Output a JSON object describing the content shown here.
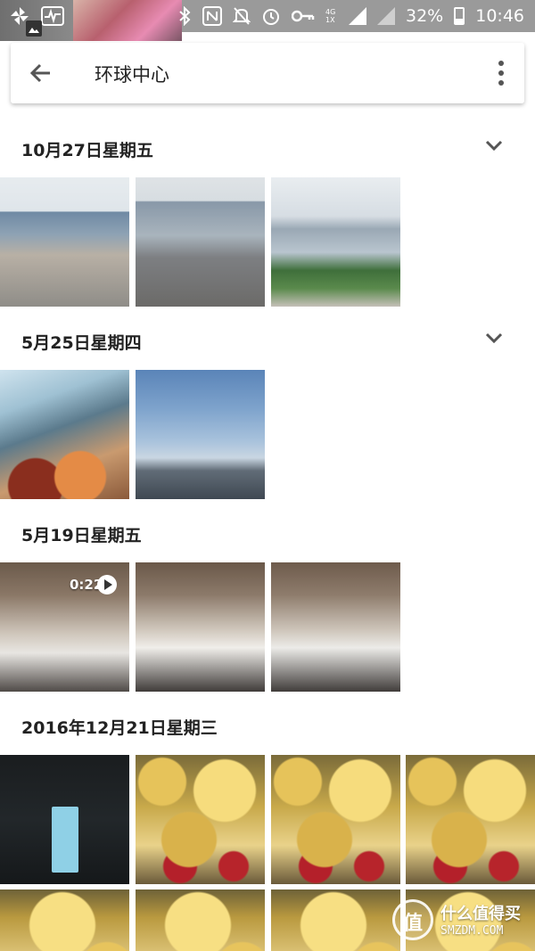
{
  "status_bar": {
    "battery_percent": "32%",
    "time": "10:46",
    "network_label": "4G 1X",
    "icons": [
      "pinwheel-icon",
      "activity-icon",
      "gallery-icon",
      "bluetooth-icon",
      "nfc-icon",
      "mute-icon",
      "alarm-icon",
      "key-icon",
      "data-arrows-icon",
      "signal-icon",
      "signal-off-icon",
      "battery-icon"
    ]
  },
  "app_bar": {
    "title": "环球中心",
    "back_icon": "back-arrow-icon",
    "menu_icon": "more-vert-icon"
  },
  "sections": [
    {
      "date": "10月27日星期五",
      "collapse_icon": "chevron-down-icon"
    },
    {
      "date": "5月25日星期四",
      "collapse_icon": "chevron-down-icon"
    },
    {
      "date": "5月19日星期五"
    },
    {
      "date": "2016年12月21日星期三"
    }
  ],
  "video_duration": "0:22",
  "watermark": {
    "logo_char": "值",
    "text": "什么值得买",
    "domain": "SMZDM.COM"
  }
}
